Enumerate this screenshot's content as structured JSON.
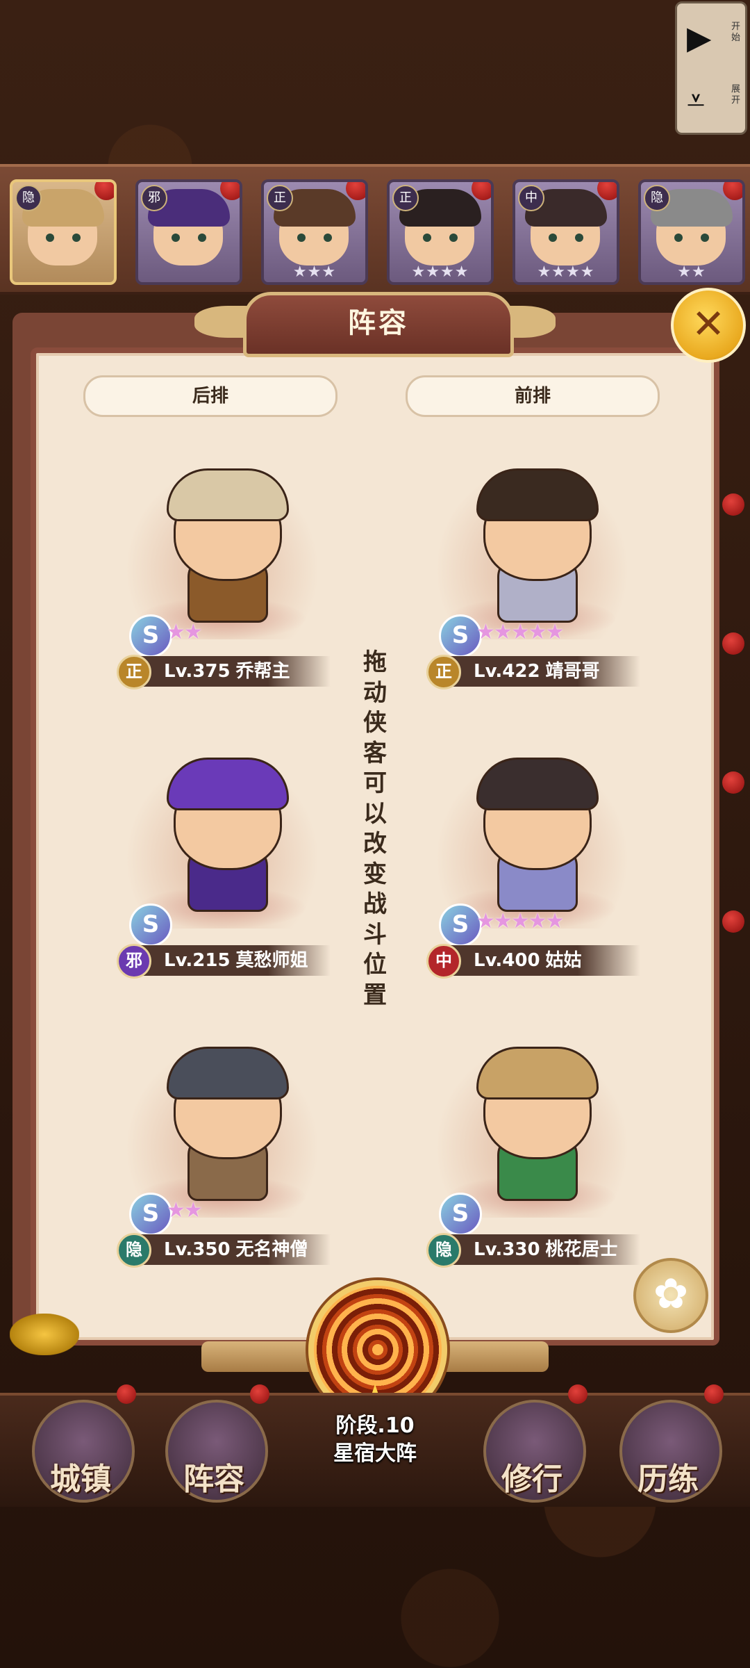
{
  "controls": {
    "start_label": "开始",
    "expand_label": "展开"
  },
  "hero_strip": [
    {
      "faction": "隐",
      "stars": "",
      "selected": true
    },
    {
      "faction": "邪",
      "stars": "",
      "selected": false
    },
    {
      "faction": "正",
      "stars": "★★★",
      "selected": false
    },
    {
      "faction": "正",
      "stars": "★★★★",
      "selected": false
    },
    {
      "faction": "中",
      "stars": "★★★★",
      "selected": false
    },
    {
      "faction": "隐",
      "stars": "★★",
      "selected": false
    }
  ],
  "panel": {
    "title": "阵容",
    "back_row_label": "后排",
    "front_row_label": "前排",
    "hint": "拖动侠客可以改变战斗位置"
  },
  "formation": {
    "back_row": [
      {
        "faction": "正",
        "level": "Lv.375",
        "name": "乔帮主",
        "stars": "★★",
        "faction_color": "#b9862a"
      },
      {
        "faction": "邪",
        "level": "Lv.215",
        "name": "莫愁师姐",
        "stars": "",
        "faction_color": "#6b3ab0"
      },
      {
        "faction": "隐",
        "level": "Lv.350",
        "name": "无名神僧",
        "stars": "★★",
        "faction_color": "#2a7a6a"
      }
    ],
    "front_row": [
      {
        "faction": "正",
        "level": "Lv.422",
        "name": "靖哥哥",
        "stars": "★★★★★",
        "faction_color": "#b9862a"
      },
      {
        "faction": "中",
        "level": "Lv.400",
        "name": "姑姑",
        "stars": "★★★★★",
        "faction_color": "#b3262a"
      },
      {
        "faction": "隐",
        "level": "Lv.330",
        "name": "桃花居士",
        "stars": "",
        "faction_color": "#2a7a6a"
      }
    ]
  },
  "stage": {
    "level": "阶段.10",
    "name": "星宿大阵"
  },
  "bottom_nav": [
    {
      "label": "城镇"
    },
    {
      "label": "阵容"
    },
    {
      "label": "修行"
    },
    {
      "label": "历练"
    }
  ]
}
